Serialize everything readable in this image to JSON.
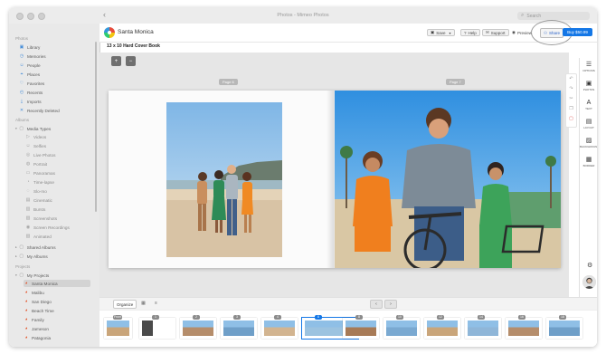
{
  "window": {
    "title": "Photos - Mimeo Photos",
    "back": "‹"
  },
  "search": {
    "placeholder": "Search"
  },
  "sidebar": {
    "sections": {
      "photos": "Photos",
      "albums": "Albums",
      "projects": "Projects"
    },
    "library": [
      {
        "label": "Library",
        "icon": "library-icon",
        "glyph": "▣"
      },
      {
        "label": "Memories",
        "icon": "memories-icon",
        "glyph": "◷"
      },
      {
        "label": "People",
        "icon": "people-icon",
        "glyph": "☺"
      },
      {
        "label": "Places",
        "icon": "places-icon",
        "glyph": "⌖"
      },
      {
        "label": "Favorites",
        "icon": "heart-icon",
        "glyph": "♡"
      },
      {
        "label": "Recents",
        "icon": "clock-icon",
        "glyph": "◴"
      },
      {
        "label": "Imports",
        "icon": "import-icon",
        "glyph": "⤓"
      },
      {
        "label": "Recently Deleted",
        "icon": "trash-icon",
        "glyph": "✕"
      }
    ],
    "media_types": {
      "label": "Media Types",
      "glyph": "▢"
    },
    "media_items": [
      {
        "label": "Videos",
        "glyph": "▷"
      },
      {
        "label": "Selfies",
        "glyph": "☺"
      },
      {
        "label": "Live Photos",
        "glyph": "◎"
      },
      {
        "label": "Portrait",
        "glyph": "◍"
      },
      {
        "label": "Panoramas",
        "glyph": "▭"
      },
      {
        "label": "Time-lapse",
        "glyph": "◔"
      },
      {
        "label": "Slo-mo",
        "glyph": "◌"
      },
      {
        "label": "Cinematic",
        "glyph": "▤"
      },
      {
        "label": "Bursts",
        "glyph": "▥"
      },
      {
        "label": "Screenshots",
        "glyph": "▨"
      },
      {
        "label": "Screen Recordings",
        "glyph": "◉"
      },
      {
        "label": "Animated",
        "glyph": "▧"
      }
    ],
    "album_groups": [
      {
        "label": "Shared Albums",
        "glyph": "▢"
      },
      {
        "label": "My Albums",
        "glyph": "▢"
      }
    ],
    "my_projects": {
      "label": "My Projects",
      "glyph": "▢"
    },
    "projects": [
      {
        "label": "Santa Monica",
        "selected": true
      },
      {
        "label": "Malibu",
        "selected": false
      },
      {
        "label": "San Diego",
        "selected": false
      },
      {
        "label": "Beach Time",
        "selected": false
      },
      {
        "label": "Family",
        "selected": false
      },
      {
        "label": "Jameson",
        "selected": false
      },
      {
        "label": "Patagonia",
        "selected": false
      }
    ]
  },
  "toolbar": {
    "project_name": "Santa Monica",
    "save": "Save",
    "help": "Help",
    "support": "Support",
    "preview": "Preview",
    "share": "Share",
    "buy": "Buy $50.99"
  },
  "book_title": "13 x 10 Hard Cover Book",
  "canvas": {
    "zoom_in": "+",
    "zoom_out": "−",
    "left_page_label": "Page 6",
    "right_page_label": "Page 7"
  },
  "right_panel": [
    {
      "label": "OPTIONS",
      "icon": "sliders-icon",
      "glyph": "☰"
    },
    {
      "label": "PHOTOS",
      "icon": "photos-icon",
      "glyph": "▣"
    },
    {
      "label": "TEXT",
      "icon": "text-icon",
      "glyph": "A"
    },
    {
      "label": "LAYOUT",
      "icon": "layout-icon",
      "glyph": "▤"
    },
    {
      "label": "BACKGROUND",
      "icon": "background-icon",
      "glyph": "▨"
    },
    {
      "label": "BORDER",
      "icon": "border-icon",
      "glyph": "▦"
    }
  ],
  "filmbar": {
    "organize": "Organize",
    "prev": "‹",
    "next": "›"
  },
  "thumbnails": [
    {
      "num": "Front",
      "selected": false
    },
    {
      "num": "1",
      "selected": false
    },
    {
      "num": "2",
      "selected": false
    },
    {
      "num": "3",
      "selected": false
    },
    {
      "num": "4",
      "selected": false
    },
    {
      "num": "6",
      "selected": true
    },
    {
      "num": "8",
      "selected": false
    },
    {
      "num": "10",
      "selected": false
    },
    {
      "num": "12",
      "selected": false
    },
    {
      "num": "14",
      "selected": false
    },
    {
      "num": "16",
      "selected": false
    },
    {
      "num": "18",
      "selected": false
    }
  ],
  "colors": {
    "accent": "#1477e6",
    "sidebar_bg": "#e9e9e9",
    "canvas_bg": "#e6e6e6"
  }
}
